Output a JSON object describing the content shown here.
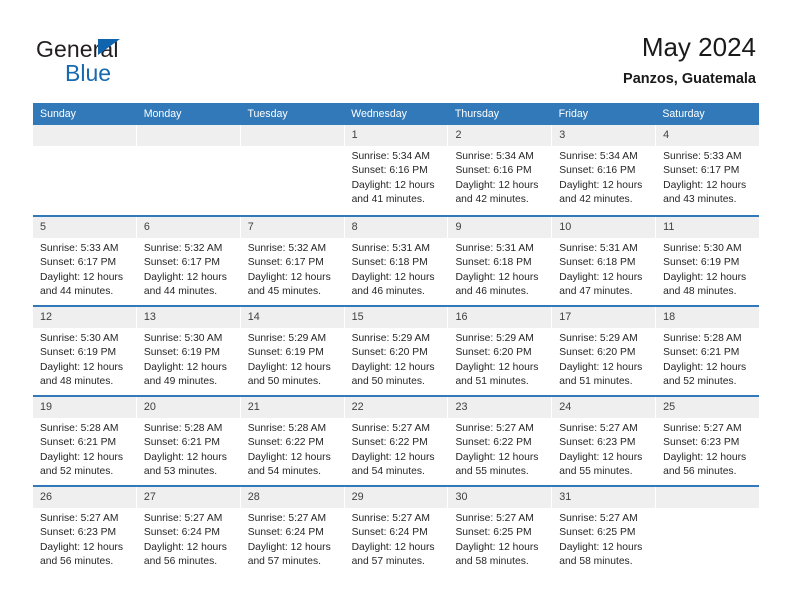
{
  "brand": {
    "name_part1": "General",
    "name_part2": "Blue",
    "logo_icon": "triangle-flag-icon",
    "accent_color": "#0f64ad"
  },
  "header": {
    "title": "May 2024",
    "subtitle": "Panzos, Guatemala"
  },
  "theme": {
    "header_row_bg": "#3179b8",
    "daynum_band_bg": "#efefef",
    "grid_line": "#3179b8",
    "text": "#262626"
  },
  "weekdays": [
    "Sunday",
    "Monday",
    "Tuesday",
    "Wednesday",
    "Thursday",
    "Friday",
    "Saturday"
  ],
  "labels": {
    "sunrise": "Sunrise:",
    "sunset": "Sunset:",
    "daylight": "Daylight:"
  },
  "weeks": [
    [
      {
        "day": "",
        "sunrise": "",
        "sunset": "",
        "daylight": "",
        "empty": true
      },
      {
        "day": "",
        "sunrise": "",
        "sunset": "",
        "daylight": "",
        "empty": true
      },
      {
        "day": "",
        "sunrise": "",
        "sunset": "",
        "daylight": "",
        "empty": true
      },
      {
        "day": "1",
        "sunrise": "Sunrise: 5:34 AM",
        "sunset": "Sunset: 6:16 PM",
        "daylight": "Daylight: 12 hours and 41 minutes."
      },
      {
        "day": "2",
        "sunrise": "Sunrise: 5:34 AM",
        "sunset": "Sunset: 6:16 PM",
        "daylight": "Daylight: 12 hours and 42 minutes."
      },
      {
        "day": "3",
        "sunrise": "Sunrise: 5:34 AM",
        "sunset": "Sunset: 6:16 PM",
        "daylight": "Daylight: 12 hours and 42 minutes."
      },
      {
        "day": "4",
        "sunrise": "Sunrise: 5:33 AM",
        "sunset": "Sunset: 6:17 PM",
        "daylight": "Daylight: 12 hours and 43 minutes."
      }
    ],
    [
      {
        "day": "5",
        "sunrise": "Sunrise: 5:33 AM",
        "sunset": "Sunset: 6:17 PM",
        "daylight": "Daylight: 12 hours and 44 minutes."
      },
      {
        "day": "6",
        "sunrise": "Sunrise: 5:32 AM",
        "sunset": "Sunset: 6:17 PM",
        "daylight": "Daylight: 12 hours and 44 minutes."
      },
      {
        "day": "7",
        "sunrise": "Sunrise: 5:32 AM",
        "sunset": "Sunset: 6:17 PM",
        "daylight": "Daylight: 12 hours and 45 minutes."
      },
      {
        "day": "8",
        "sunrise": "Sunrise: 5:31 AM",
        "sunset": "Sunset: 6:18 PM",
        "daylight": "Daylight: 12 hours and 46 minutes."
      },
      {
        "day": "9",
        "sunrise": "Sunrise: 5:31 AM",
        "sunset": "Sunset: 6:18 PM",
        "daylight": "Daylight: 12 hours and 46 minutes."
      },
      {
        "day": "10",
        "sunrise": "Sunrise: 5:31 AM",
        "sunset": "Sunset: 6:18 PM",
        "daylight": "Daylight: 12 hours and 47 minutes."
      },
      {
        "day": "11",
        "sunrise": "Sunrise: 5:30 AM",
        "sunset": "Sunset: 6:19 PM",
        "daylight": "Daylight: 12 hours and 48 minutes."
      }
    ],
    [
      {
        "day": "12",
        "sunrise": "Sunrise: 5:30 AM",
        "sunset": "Sunset: 6:19 PM",
        "daylight": "Daylight: 12 hours and 48 minutes."
      },
      {
        "day": "13",
        "sunrise": "Sunrise: 5:30 AM",
        "sunset": "Sunset: 6:19 PM",
        "daylight": "Daylight: 12 hours and 49 minutes."
      },
      {
        "day": "14",
        "sunrise": "Sunrise: 5:29 AM",
        "sunset": "Sunset: 6:19 PM",
        "daylight": "Daylight: 12 hours and 50 minutes."
      },
      {
        "day": "15",
        "sunrise": "Sunrise: 5:29 AM",
        "sunset": "Sunset: 6:20 PM",
        "daylight": "Daylight: 12 hours and 50 minutes."
      },
      {
        "day": "16",
        "sunrise": "Sunrise: 5:29 AM",
        "sunset": "Sunset: 6:20 PM",
        "daylight": "Daylight: 12 hours and 51 minutes."
      },
      {
        "day": "17",
        "sunrise": "Sunrise: 5:29 AM",
        "sunset": "Sunset: 6:20 PM",
        "daylight": "Daylight: 12 hours and 51 minutes."
      },
      {
        "day": "18",
        "sunrise": "Sunrise: 5:28 AM",
        "sunset": "Sunset: 6:21 PM",
        "daylight": "Daylight: 12 hours and 52 minutes."
      }
    ],
    [
      {
        "day": "19",
        "sunrise": "Sunrise: 5:28 AM",
        "sunset": "Sunset: 6:21 PM",
        "daylight": "Daylight: 12 hours and 52 minutes."
      },
      {
        "day": "20",
        "sunrise": "Sunrise: 5:28 AM",
        "sunset": "Sunset: 6:21 PM",
        "daylight": "Daylight: 12 hours and 53 minutes."
      },
      {
        "day": "21",
        "sunrise": "Sunrise: 5:28 AM",
        "sunset": "Sunset: 6:22 PM",
        "daylight": "Daylight: 12 hours and 54 minutes."
      },
      {
        "day": "22",
        "sunrise": "Sunrise: 5:27 AM",
        "sunset": "Sunset: 6:22 PM",
        "daylight": "Daylight: 12 hours and 54 minutes."
      },
      {
        "day": "23",
        "sunrise": "Sunrise: 5:27 AM",
        "sunset": "Sunset: 6:22 PM",
        "daylight": "Daylight: 12 hours and 55 minutes."
      },
      {
        "day": "24",
        "sunrise": "Sunrise: 5:27 AM",
        "sunset": "Sunset: 6:23 PM",
        "daylight": "Daylight: 12 hours and 55 minutes."
      },
      {
        "day": "25",
        "sunrise": "Sunrise: 5:27 AM",
        "sunset": "Sunset: 6:23 PM",
        "daylight": "Daylight: 12 hours and 56 minutes."
      }
    ],
    [
      {
        "day": "26",
        "sunrise": "Sunrise: 5:27 AM",
        "sunset": "Sunset: 6:23 PM",
        "daylight": "Daylight: 12 hours and 56 minutes."
      },
      {
        "day": "27",
        "sunrise": "Sunrise: 5:27 AM",
        "sunset": "Sunset: 6:24 PM",
        "daylight": "Daylight: 12 hours and 56 minutes."
      },
      {
        "day": "28",
        "sunrise": "Sunrise: 5:27 AM",
        "sunset": "Sunset: 6:24 PM",
        "daylight": "Daylight: 12 hours and 57 minutes."
      },
      {
        "day": "29",
        "sunrise": "Sunrise: 5:27 AM",
        "sunset": "Sunset: 6:24 PM",
        "daylight": "Daylight: 12 hours and 57 minutes."
      },
      {
        "day": "30",
        "sunrise": "Sunrise: 5:27 AM",
        "sunset": "Sunset: 6:25 PM",
        "daylight": "Daylight: 12 hours and 58 minutes."
      },
      {
        "day": "31",
        "sunrise": "Sunrise: 5:27 AM",
        "sunset": "Sunset: 6:25 PM",
        "daylight": "Daylight: 12 hours and 58 minutes."
      },
      {
        "day": "",
        "sunrise": "",
        "sunset": "",
        "daylight": "",
        "empty": true
      }
    ]
  ]
}
